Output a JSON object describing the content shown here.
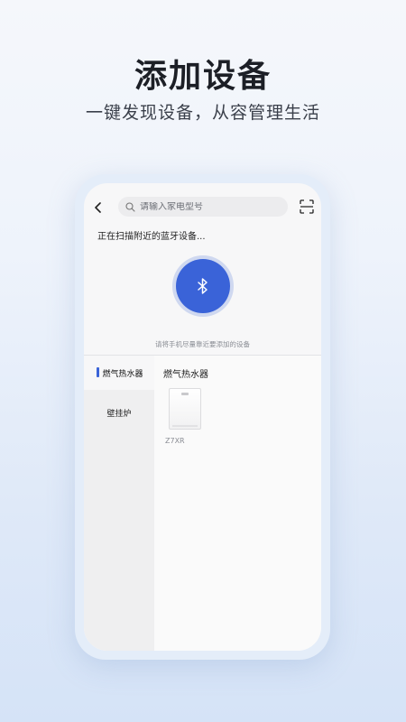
{
  "promo": {
    "title": "添加设备",
    "subtitle": "一键发现设备，从容管理生活"
  },
  "topbar": {
    "search_placeholder": "请输入家电型号"
  },
  "scan": {
    "status_text": "正在扫描附近的蓝牙设备...",
    "hint": "请将手机尽量靠近要添加的设备"
  },
  "sidebar": {
    "items": [
      {
        "label": "燃气热水器"
      },
      {
        "label": "壁挂炉"
      }
    ]
  },
  "content": {
    "category_title": "燃气热水器",
    "devices": [
      {
        "name": "Z7XR"
      }
    ]
  },
  "colors": {
    "accent": "#3a63d8",
    "background_top": "#f5f7fb",
    "background_bottom": "#d5e3f7"
  }
}
